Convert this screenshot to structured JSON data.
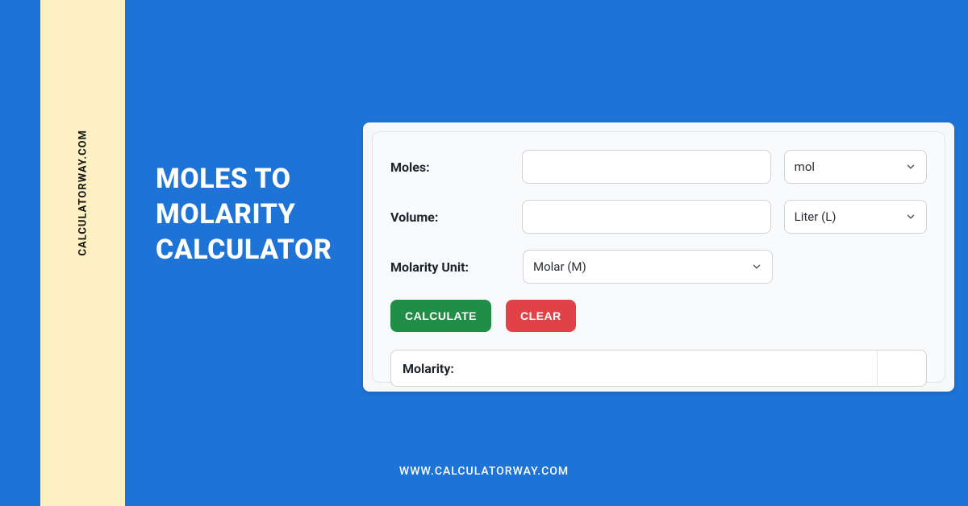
{
  "colors": {
    "page_bg": "#1e73d6",
    "cream": "#fdf0c3",
    "btn_green": "#218e48",
    "btn_red": "#e04247"
  },
  "decor": {
    "rotated_brand": "CALCULATORWAY.COM",
    "title_line1": "MOLES TO",
    "title_line2": "MOLARITY",
    "title_line3": "CALCULATOR",
    "footer_url": "WWW.CALCULATORWAY.COM"
  },
  "form": {
    "moles": {
      "label": "Moles:",
      "value": "",
      "unit_selected": "mol"
    },
    "volume": {
      "label": "Volume:",
      "value": "",
      "unit_selected": "Liter (L)"
    },
    "molarity_unit": {
      "label": "Molarity Unit:",
      "selected": "Molar (M)"
    },
    "buttons": {
      "calculate": "CALCULATE",
      "clear": "CLEAR"
    },
    "result": {
      "label": "Molarity:",
      "unit": ""
    }
  }
}
